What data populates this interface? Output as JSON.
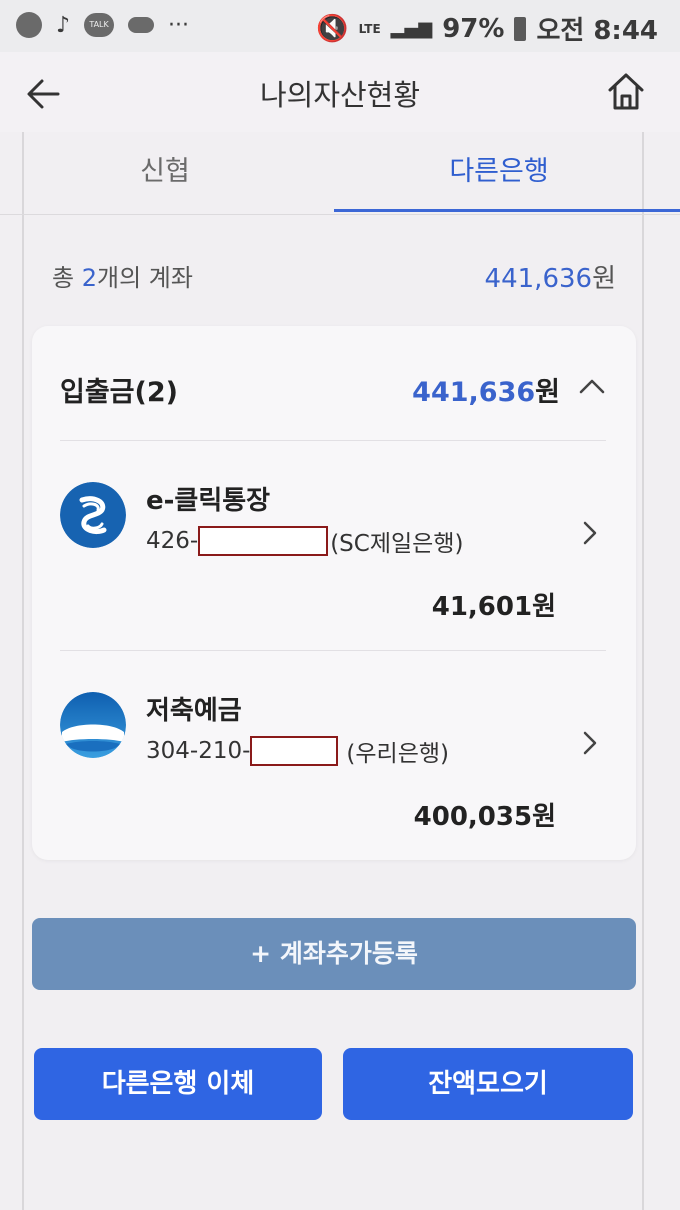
{
  "status_bar": {
    "talk_label": "TALK",
    "more": "···",
    "network": "LTE",
    "battery": "97%",
    "time": "오전 8:44"
  },
  "header": {
    "title": "나의자산현황"
  },
  "tabs": [
    {
      "label": "신협",
      "active": false
    },
    {
      "label": "다른은행",
      "active": true
    }
  ],
  "summary": {
    "prefix": "총 ",
    "count": "2",
    "suffix": "개의 계좌",
    "amount": "441,636",
    "currency": "원"
  },
  "deposit_group": {
    "title": "입출금(2)",
    "total": "441,636",
    "currency": "원",
    "accounts": [
      {
        "name": "e-클릭통장",
        "number_prefix": "426-",
        "bank": "(SC제일은행)",
        "amount": "41,601원",
        "logo": "sc-bank-logo"
      },
      {
        "name": "저축예금",
        "number_prefix": "304-210-",
        "bank": "(우리은행)",
        "amount": "400,035원",
        "logo": "woori-bank-logo"
      }
    ]
  },
  "actions": {
    "add_account": "+ 계좌추가등록",
    "other_bank_transfer": "다른은행 이체",
    "collect_balance": "잔액모으기"
  },
  "colors": {
    "accent": "#3a63cc",
    "primary_button": "#2f65e3",
    "secondary_button": "#6b8fba",
    "sc_bank": "#1763b1",
    "woori_bank": "#1a7ac6"
  }
}
